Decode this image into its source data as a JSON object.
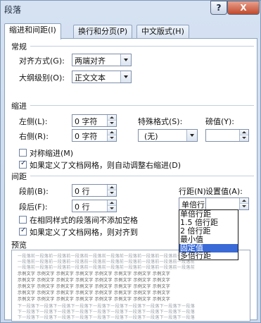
{
  "window": {
    "title": "段落",
    "help": "?",
    "close": "X"
  },
  "tabs": [
    {
      "label": "缩进和间距(I)"
    },
    {
      "label": "换行和分页(P)"
    },
    {
      "label": "中文版式(H)"
    }
  ],
  "general": {
    "heading": "常规",
    "alignment_label": "对齐方式(G):",
    "alignment_value": "两端对齐",
    "outline_label": "大纲级别(O):",
    "outline_value": "正文文本"
  },
  "indent": {
    "heading": "缩进",
    "left_label": "左侧(L):",
    "left_value": "0 字符",
    "right_label": "右侧(R):",
    "right_value": "0 字符",
    "special_label": "特殊格式(S):",
    "special_value": "(无)",
    "by_label": "磅值(Y):",
    "mirror_label": "对称缩进(M)",
    "mirror_checked": false,
    "grid_label": "如果定义了文档网格，则自动调整右缩进(D)",
    "grid_checked": true
  },
  "spacing": {
    "heading": "间距",
    "before_label": "段前(B):",
    "before_value": "0 行",
    "after_label": "段后(F):",
    "after_value": "0 行",
    "line_label": "行距(N):",
    "line_value": "单倍行距",
    "at_label": "设置值(A):",
    "no_space_label": "在相同样式的段落间不添加空格",
    "no_space_checked": false,
    "snap_label": "如果定义了文档网格，则对齐到",
    "snap_checked": true
  },
  "line_spacing_options": [
    {
      "label": "单倍行距",
      "selected": false
    },
    {
      "label": "1.5 倍行距",
      "selected": false
    },
    {
      "label": "2 倍行距",
      "selected": false
    },
    {
      "label": "最小值",
      "selected": false
    },
    {
      "label": "固定值",
      "selected": true
    },
    {
      "label": "多倍行距",
      "selected": false
    }
  ],
  "preview": {
    "heading": "预览",
    "prev_para": "一段落前一段落前一段落前一段落前一段落前一段落前一段落前一段落前一段落前一段落前",
    "sample": "示例文字 示例文字 示例文字 示例文字 示例文字 示例文字 示例文字 示例文字",
    "next_para": "下一段落下一段落下一段落下一段落下一段落下一段落下一段落下一段落下一段落下一段落"
  },
  "colors": {
    "selection": "#3a6ad6",
    "dialog_bg": "#d6e2f2",
    "close_red": "#c14a2c"
  }
}
